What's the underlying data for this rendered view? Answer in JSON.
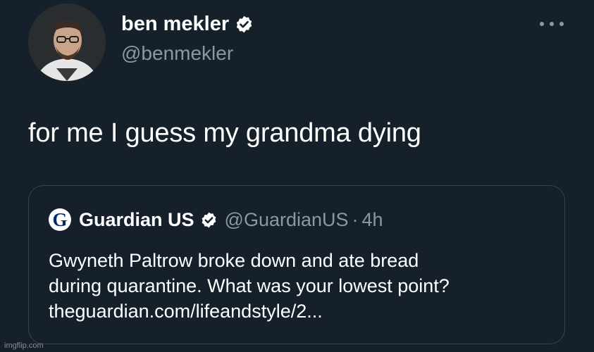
{
  "author": {
    "name": "ben mekler",
    "handle": "@benmekler",
    "verified": true,
    "avatar_icon": "profile-photo"
  },
  "tweet": {
    "text": "for me I guess my grandma dying"
  },
  "more_icon": "more-horizontal-icon",
  "quoted": {
    "logo_letter": "G",
    "name": "Guardian US",
    "verified": true,
    "handle": "@GuardianUS",
    "separator": "·",
    "time": "4h",
    "lines": [
      "Gwyneth Paltrow broke down and ate bread",
      "during quarantine. What was your lowest point?",
      "theguardian.com/lifeandstyle/2..."
    ]
  },
  "watermark": "imgflip.com",
  "colors": {
    "background": "#15202b",
    "secondary_text": "#8899a6",
    "border": "#38444d",
    "verified_badge": "#ffffff",
    "guardian_blue": "#052962"
  }
}
